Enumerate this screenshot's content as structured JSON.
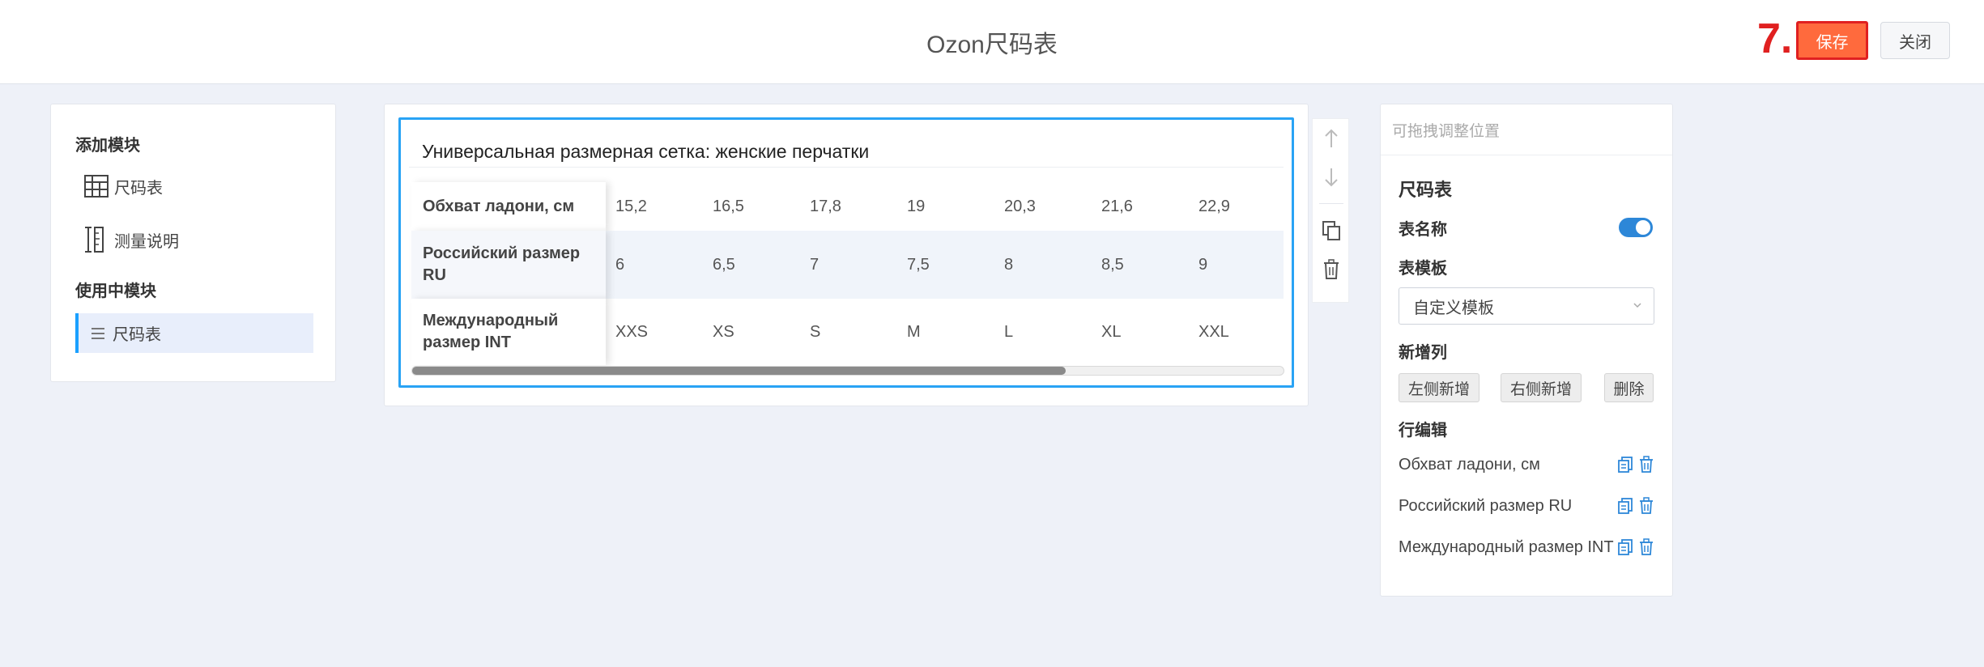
{
  "header": {
    "title": "Ozon尺码表",
    "step_marker": "7.",
    "save_label": "保存",
    "close_label": "关闭"
  },
  "left_panel": {
    "add_modules_title": "添加模块",
    "add_modules": [
      {
        "label": "尺码表",
        "icon": "table-icon"
      },
      {
        "label": "测量说明",
        "icon": "ruler-icon"
      }
    ],
    "in_use_title": "使用中模块",
    "in_use": [
      {
        "label": "尺码表",
        "icon": "drag-handle-icon"
      }
    ]
  },
  "size_table": {
    "title": "Универсальная размерная сетка: женские перчатки",
    "rows": [
      {
        "header": "Обхват ладони, см",
        "cells": [
          "15,2",
          "16,5",
          "17,8",
          "19",
          "20,3",
          "21,6",
          "22,9"
        ]
      },
      {
        "header": "Российский размер RU",
        "cells": [
          "6",
          "6,5",
          "7",
          "7,5",
          "8",
          "8,5",
          "9"
        ]
      },
      {
        "header": "Международный размер INT",
        "cells": [
          "XXS",
          "XS",
          "S",
          "M",
          "L",
          "XL",
          "XXL"
        ]
      }
    ],
    "scroll_fraction": 0.75
  },
  "tools": [
    "arrow-up-icon",
    "arrow-down-icon",
    "copy-icon",
    "trash-icon"
  ],
  "right_panel": {
    "hint": "可拖拽调整位置",
    "heading": "尺码表",
    "table_name_label": "表名称",
    "table_name_enabled": true,
    "template_label": "表模板",
    "template_value": "自定义模板",
    "new_column_label": "新增列",
    "add_left_label": "左侧新增",
    "add_right_label": "右侧新增",
    "delete_label": "删除",
    "row_edit_label": "行编辑",
    "row_edits": [
      "Обхват ладони, см",
      "Российский размер RU",
      "Международный размер INT"
    ]
  },
  "colors": {
    "accent_blue": "#29a3f5",
    "save_orange": "#ff6a3d",
    "marker_red": "#e02020",
    "toggle_blue": "#2d87d8"
  }
}
